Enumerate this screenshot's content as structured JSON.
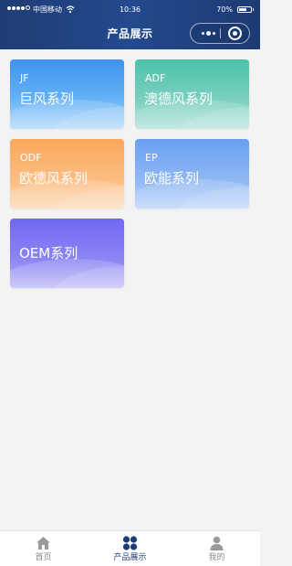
{
  "status_bar": {
    "carrier": "中国移动",
    "time": "10:36",
    "battery": "70%",
    "battery_level": 0.7
  },
  "nav": {
    "title": "产品展示"
  },
  "products": [
    {
      "code": "JF",
      "name": "巨风系列"
    },
    {
      "code": "ADF",
      "name": "澳德风系列"
    },
    {
      "code": "ODF",
      "name": "欧德风系列"
    },
    {
      "code": "EP",
      "name": "欧能系列"
    },
    {
      "code": "",
      "name": "OEM系列"
    }
  ],
  "tabbar": {
    "items": [
      {
        "label": "首页",
        "icon": "home-icon",
        "active": false
      },
      {
        "label": "产品展示",
        "icon": "grid-icon",
        "active": true
      },
      {
        "label": "我的",
        "icon": "user-icon",
        "active": false
      }
    ]
  },
  "colors": {
    "header": "#234a8e",
    "active_tab": "#1f3c75",
    "inactive_tab": "#8a8a8a",
    "background": "#f3f3f3"
  }
}
